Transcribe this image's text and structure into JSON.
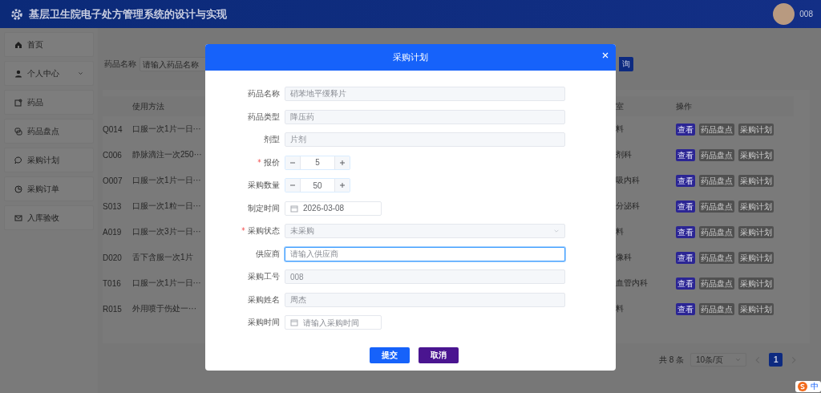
{
  "header": {
    "title": "基层卫生院电子处方管理系统的设计与实现",
    "user": "008"
  },
  "sidebar": {
    "items": [
      {
        "label": "首页"
      },
      {
        "label": "个人中心",
        "expanded": false
      },
      {
        "label": "药品"
      },
      {
        "label": "药品盘点"
      },
      {
        "label": "采购计划"
      },
      {
        "label": "采购订单"
      },
      {
        "label": "入库验收"
      }
    ]
  },
  "search": {
    "label": "药品名称",
    "placeholder": "请输入药品名称",
    "button": "询"
  },
  "table": {
    "headers": {
      "method": "使用方法",
      "column_3": "室",
      "actions": "操作"
    },
    "rows": [
      {
        "column_1": "Q014",
        "method": "口服一次1片一日···",
        "column_3": "料",
        "actions": [
          {
            "label": "查看",
            "kind": "primary"
          },
          {
            "label": "药品盘点",
            "kind": "default"
          },
          {
            "label": "采购计划",
            "kind": "default"
          }
        ]
      },
      {
        "column_1": "C006",
        "method": "静脉滴注一次250···",
        "column_3": "剂科",
        "actions": [
          {
            "label": "查看",
            "kind": "primary"
          },
          {
            "label": "药品盘点",
            "kind": "default"
          },
          {
            "label": "采购计划",
            "kind": "default"
          }
        ]
      },
      {
        "column_1": "O007",
        "method": "口服一次1片一日···",
        "column_3": "吸内科",
        "actions": [
          {
            "label": "查看",
            "kind": "primary"
          },
          {
            "label": "药品盘点",
            "kind": "default"
          },
          {
            "label": "采购计划",
            "kind": "default"
          }
        ]
      },
      {
        "column_1": "S013",
        "method": "口服一次1粒一日···",
        "column_3": "分泌科",
        "actions": [
          {
            "label": "查看",
            "kind": "primary"
          },
          {
            "label": "药品盘点",
            "kind": "default"
          },
          {
            "label": "采购计划",
            "kind": "default"
          }
        ]
      },
      {
        "column_1": "A019",
        "method": "口服一次3片一日···",
        "column_3": "料",
        "actions": [
          {
            "label": "查看",
            "kind": "primary"
          },
          {
            "label": "药品盘点",
            "kind": "default"
          },
          {
            "label": "采购计划",
            "kind": "default"
          }
        ]
      },
      {
        "column_1": "D020",
        "method": "舌下含服一次1片",
        "column_3": "像科",
        "actions": [
          {
            "label": "查看",
            "kind": "primary"
          },
          {
            "label": "药品盘点",
            "kind": "default"
          },
          {
            "label": "采购计划",
            "kind": "default"
          }
        ]
      },
      {
        "column_1": "T016",
        "method": "口服一次1片一日···",
        "column_3": "血管内科",
        "actions": [
          {
            "label": "查看",
            "kind": "primary"
          },
          {
            "label": "药品盘点",
            "kind": "default"
          },
          {
            "label": "采购计划",
            "kind": "default"
          }
        ]
      },
      {
        "column_1": "R015",
        "method": "外用喷于伤处一···",
        "column_3": "料",
        "actions": [
          {
            "label": "查看",
            "kind": "primary"
          },
          {
            "label": "药品盘点",
            "kind": "default"
          },
          {
            "label": "采购计划",
            "kind": "default"
          }
        ]
      }
    ]
  },
  "pagination": {
    "total": "共 8 条",
    "page_size": "10条/页",
    "pages": [
      {
        "label": "1",
        "selected": true
      }
    ]
  },
  "dialog": {
    "title": "采购计划",
    "fields": [
      {
        "label": "药品名称",
        "kind": "text",
        "value": "硝苯地平缓释片",
        "disabled": true,
        "required": false,
        "focused": false
      },
      {
        "label": "药品类型",
        "kind": "text",
        "value": "降压药",
        "disabled": true,
        "required": false,
        "focused": false
      },
      {
        "label": "剂型",
        "kind": "text",
        "value": "片剂",
        "disabled": true,
        "required": false,
        "focused": false
      },
      {
        "label": "报价",
        "kind": "number",
        "value": "5",
        "disabled": false,
        "required": true,
        "focused": false
      },
      {
        "label": "采购数量",
        "kind": "number",
        "value": "50",
        "disabled": false,
        "required": false,
        "focused": false
      },
      {
        "label": "制定时间",
        "kind": "date",
        "value": "2026-03-08",
        "disabled": false,
        "required": false,
        "focused": false
      },
      {
        "label": "采购状态",
        "kind": "select",
        "value": "未采购",
        "disabled": true,
        "required": true,
        "focused": false
      },
      {
        "label": "供应商",
        "kind": "text",
        "placeholder": "请输入供应商",
        "disabled": false,
        "required": false,
        "focused": true
      },
      {
        "label": "采购工号",
        "kind": "text",
        "value": "008",
        "disabled": true,
        "required": false,
        "focused": false
      },
      {
        "label": "采购姓名",
        "kind": "text",
        "value": "周杰",
        "disabled": true,
        "required": false,
        "focused": false
      },
      {
        "label": "采购时间",
        "kind": "date",
        "placeholder": "请输入采购时间",
        "disabled": false,
        "required": false,
        "focused": false
      }
    ],
    "buttons": [
      {
        "label": "提交",
        "kind": "primary"
      },
      {
        "label": "取消",
        "kind": "cancel"
      }
    ]
  },
  "ime": {
    "mode": "中"
  }
}
